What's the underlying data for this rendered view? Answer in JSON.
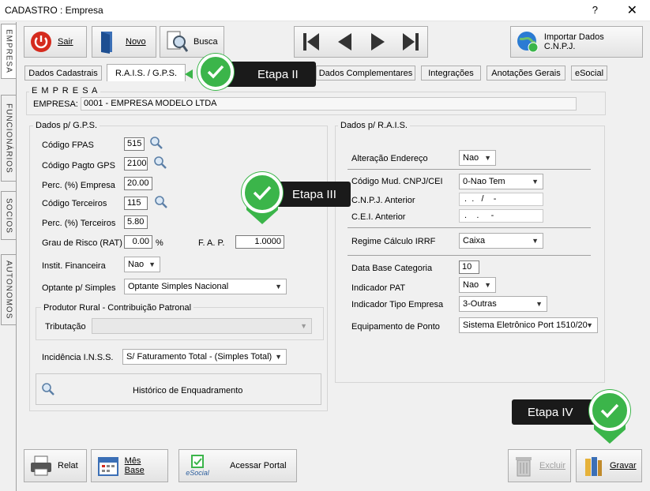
{
  "window": {
    "title": "CADASTRO : Empresa",
    "help": "?",
    "close": "✕"
  },
  "side_tabs": [
    "EMPRESA",
    "FUNCIONÁRIOS",
    "SOCIOS",
    "AUTONOMOS"
  ],
  "toolbar": {
    "sair": "Sair",
    "novo": "Novo",
    "busca": "Busca",
    "importar": "Importar Dados C.N.P.J."
  },
  "tabs": [
    "Dados Cadastrais",
    "R.A.I.S. / G.P.S.",
    "Dados Complementares",
    "Integrações",
    "Anotações Gerais",
    "eSocial"
  ],
  "empresa": {
    "group": "E M P R E S A",
    "label": "EMPRESA:",
    "value": "0001 - EMPRESA MODELO LTDA"
  },
  "gps": {
    "group": "Dados p/ G.P.S.",
    "fpas_label": "Código FPAS",
    "fpas": "515",
    "pagto_label": "Código Pagto GPS",
    "pagto": "2100",
    "perc_empresa_label": "Perc. (%) Empresa",
    "perc_empresa": "20.00",
    "cod_terceiros_label": "Código Terceiros",
    "cod_terceiros": "115",
    "perc_terceiros_label": "Perc. (%) Terceiros",
    "perc_terceiros": "5.80",
    "rat_label": "Grau de Risco (RAT)",
    "rat": "0.00",
    "rat_unit": "%",
    "fap_label": "F. A. P.",
    "fap": "1.0000",
    "instit_label": "Instit. Financeira",
    "instit": "Nao",
    "optante_label": "Optante p/ Simples",
    "optante": "Optante Simples Nacional",
    "produtor_group": "Produtor Rural - Contribuição Patronal",
    "tributacao_label": "Tributação",
    "tributacao": "",
    "incidencia_label": "Incidência  I.N.S.S.",
    "incidencia": "S/ Faturamento Total - (Simples Total)",
    "historico": "Histórico de Enquadramento"
  },
  "rais": {
    "group": "Dados p/ R.A.I.S.",
    "alteracao_label": "Alteração Endereço",
    "alteracao": "Nao",
    "codmud_label": "Código Mud. CNPJ/CEI",
    "codmud": "0-Nao Tem",
    "cnpj_label": "C.N.P.J. Anterior",
    "cnpj": " .  .   /    -",
    "cei_label": "C.E.I. Anterior",
    "cei": " .    .     -",
    "irrf_label": "Regime Cálculo IRRF",
    "irrf": "Caixa",
    "database_label": "Data Base Categoria",
    "database": "10",
    "pat_label": "Indicador PAT",
    "pat": "Nao",
    "tipo_label": "Indicador Tipo Empresa",
    "tipo": "3-Outras",
    "ponto_label": "Equipamento de Ponto",
    "ponto": "Sistema Eletrônico Port 1510/20"
  },
  "bottom": {
    "relat": "Relat",
    "mesbase": "Mês Base",
    "esocial_logo": "eSocial",
    "portal": "Acessar Portal",
    "excluir": "Excluir",
    "gravar": "Gravar"
  },
  "callouts": {
    "etapa2": "Etapa II",
    "etapa3": "Etapa III",
    "etapa4": "Etapa IV"
  },
  "colors": {
    "callout_bg": "#1a1a1a",
    "check_green": "#3bb54a"
  }
}
